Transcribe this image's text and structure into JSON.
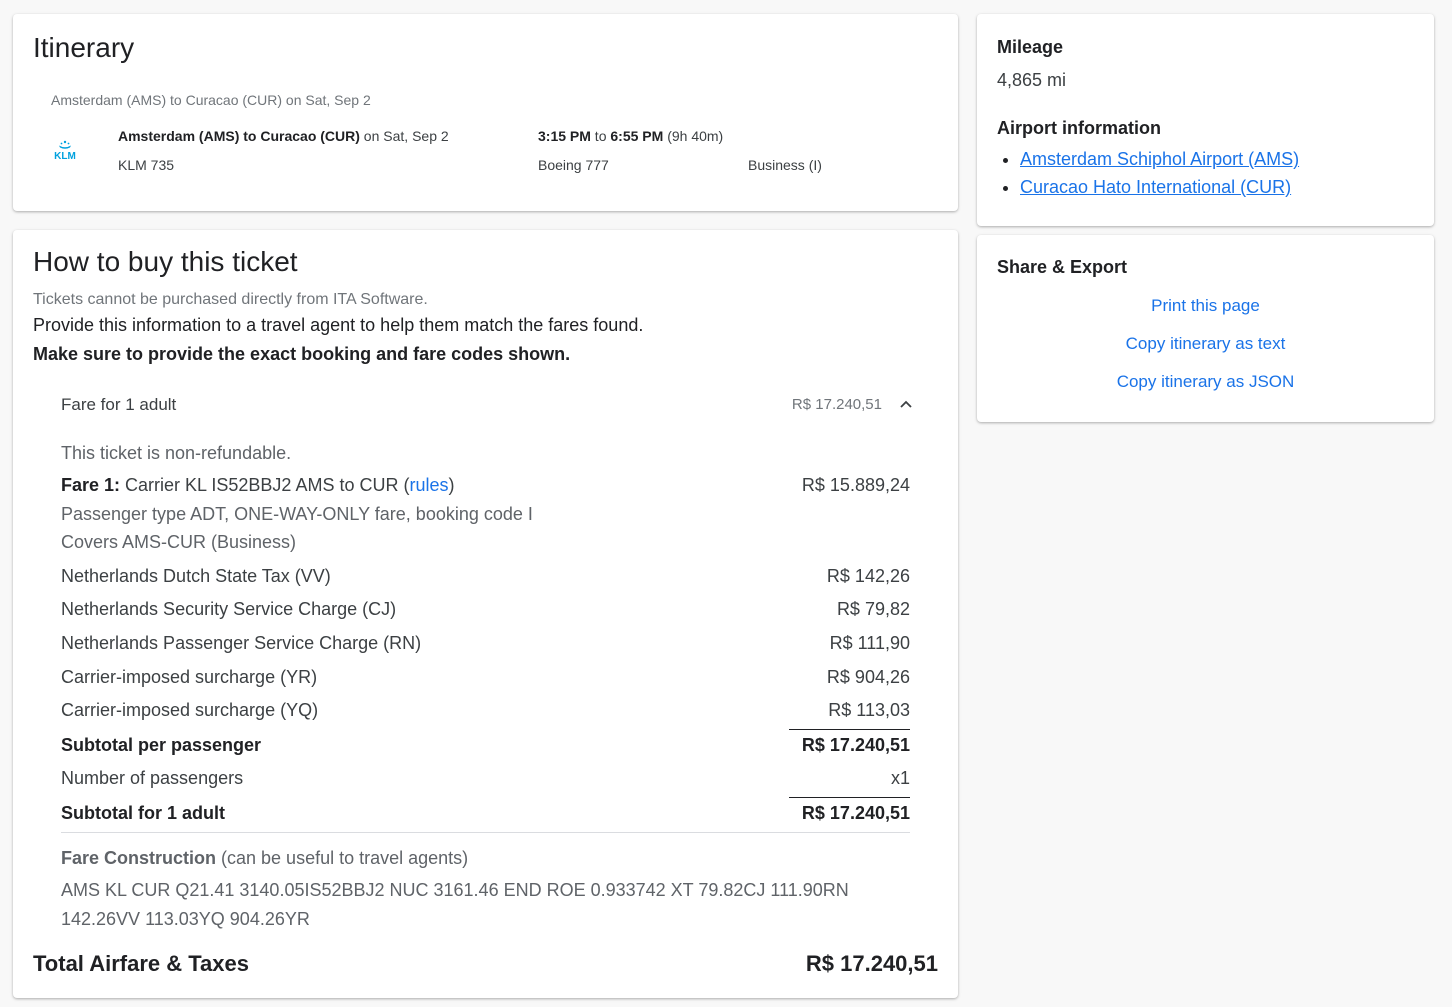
{
  "itinerary": {
    "title": "Itinerary",
    "route_summary": "Amsterdam (AMS) to Curacao (CUR) on Sat, Sep 2",
    "segment": {
      "airline_logo_text": "KLM",
      "route_bold": "Amsterdam (AMS) to Curacao (CUR)",
      "route_date": " on Sat, Sep 2",
      "flight": "KLM 735",
      "depart": "3:15 PM",
      "to_word": " to ",
      "arrive": "6:55 PM",
      "duration": " (9h 40m)",
      "aircraft": "Boeing 777",
      "cabin": "Business (I)"
    }
  },
  "buy": {
    "title": "How to buy this ticket",
    "note_cannot": "Tickets cannot be purchased directly from ITA Software.",
    "note_provide": "Provide this information to a travel agent to help them match the fares found.",
    "note_exact": "Make sure to provide the exact booking and fare codes shown.",
    "fare_header_label": "Fare for 1 adult",
    "fare_header_amount": "R$ 17.240,51",
    "non_refundable": "This ticket is non-refundable.",
    "fare1_label": "Fare 1:",
    "fare1_desc": " Carrier KL IS52BBJ2 AMS to CUR (",
    "fare1_rules": "rules",
    "fare1_close": ")",
    "fare1_amount": "R$ 15.889,24",
    "fare1_passenger": "Passenger type ADT, ONE-WAY-ONLY fare, booking code I",
    "fare1_covers": "Covers AMS-CUR (Business)",
    "taxes": [
      {
        "label": "Netherlands Dutch State Tax (VV)",
        "amount": "R$ 142,26"
      },
      {
        "label": "Netherlands Security Service Charge (CJ)",
        "amount": "R$ 79,82"
      },
      {
        "label": "Netherlands Passenger Service Charge (RN)",
        "amount": "R$ 111,90"
      },
      {
        "label": "Carrier-imposed surcharge (YR)",
        "amount": "R$ 904,26"
      },
      {
        "label": "Carrier-imposed surcharge (YQ)",
        "amount": "R$ 113,03"
      }
    ],
    "subtotal_per_pax_label": "Subtotal per passenger",
    "subtotal_per_pax_amount": "R$ 17.240,51",
    "num_pax_label": "Number of passengers",
    "num_pax_value": "x1",
    "subtotal_adult_label": "Subtotal for 1 adult",
    "subtotal_adult_amount": "R$ 17.240,51",
    "fc_label": "Fare Construction",
    "fc_note": " (can be useful to travel agents)",
    "fc_text": "AMS KL CUR Q21.41 3140.05IS52BBJ2 NUC 3161.46 END ROE 0.933742 XT 79.82CJ 111.90RN 142.26VV 113.03YQ 904.26YR",
    "total_label": "Total Airfare & Taxes",
    "total_amount": "R$ 17.240,51"
  },
  "mileage": {
    "title": "Mileage",
    "value": "4,865 mi",
    "airport_title": "Airport information",
    "airports": [
      "Amsterdam Schiphol Airport (AMS)",
      "Curacao Hato International (CUR)"
    ]
  },
  "share": {
    "title": "Share & Export",
    "print": "Print this page",
    "copy_text": "Copy itinerary as text",
    "copy_json": "Copy itinerary as JSON"
  },
  "colors": {
    "link": "#1a73e8",
    "klm_blue": "#00a1de"
  }
}
